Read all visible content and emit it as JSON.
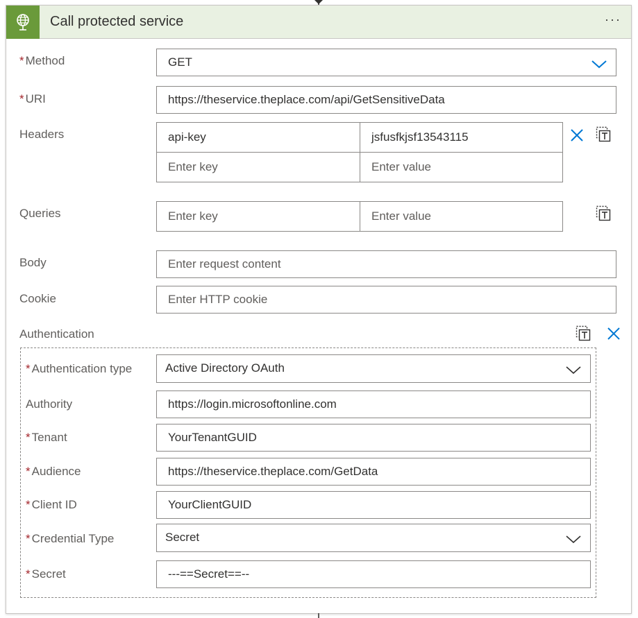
{
  "card": {
    "title": "Call protected service",
    "menu_glyph": "···",
    "icon": "globe-icon",
    "accent": "#6a9a3a",
    "header_bg": "#e9f1e2"
  },
  "required_marker": "*",
  "method": {
    "label": "Method",
    "value": "GET",
    "required": true
  },
  "uri": {
    "label": "URI",
    "value": "https://theservice.theplace.com/api/GetSensitiveData",
    "required": true
  },
  "headers": {
    "label": "Headers",
    "rows": [
      {
        "key": "api-key",
        "value": "jsfusfkjsf13543115"
      }
    ],
    "key_placeholder": "Enter key",
    "value_placeholder": "Enter value"
  },
  "queries": {
    "label": "Queries",
    "key_placeholder": "Enter key",
    "value_placeholder": "Enter value"
  },
  "body": {
    "label": "Body",
    "placeholder": "Enter request content"
  },
  "cookie": {
    "label": "Cookie",
    "placeholder": "Enter HTTP cookie"
  },
  "authentication": {
    "label": "Authentication",
    "type": {
      "label": "Authentication type",
      "value": "Active Directory OAuth"
    },
    "authority": {
      "label": "Authority",
      "value": "https://login.microsoftonline.com"
    },
    "tenant": {
      "label": "Tenant",
      "value": "YourTenantGUID"
    },
    "audience": {
      "label": "Audience",
      "value": "https://theservice.theplace.com/GetData"
    },
    "client_id": {
      "label": "Client ID",
      "value": "YourClientGUID"
    },
    "credential_type": {
      "label": "Credential Type",
      "value": "Secret"
    },
    "secret": {
      "label": "Secret",
      "value": "---==Secret==--"
    }
  },
  "colors": {
    "required": "#a4262c",
    "link_blue": "#0078d4",
    "border": "#8a8886"
  }
}
